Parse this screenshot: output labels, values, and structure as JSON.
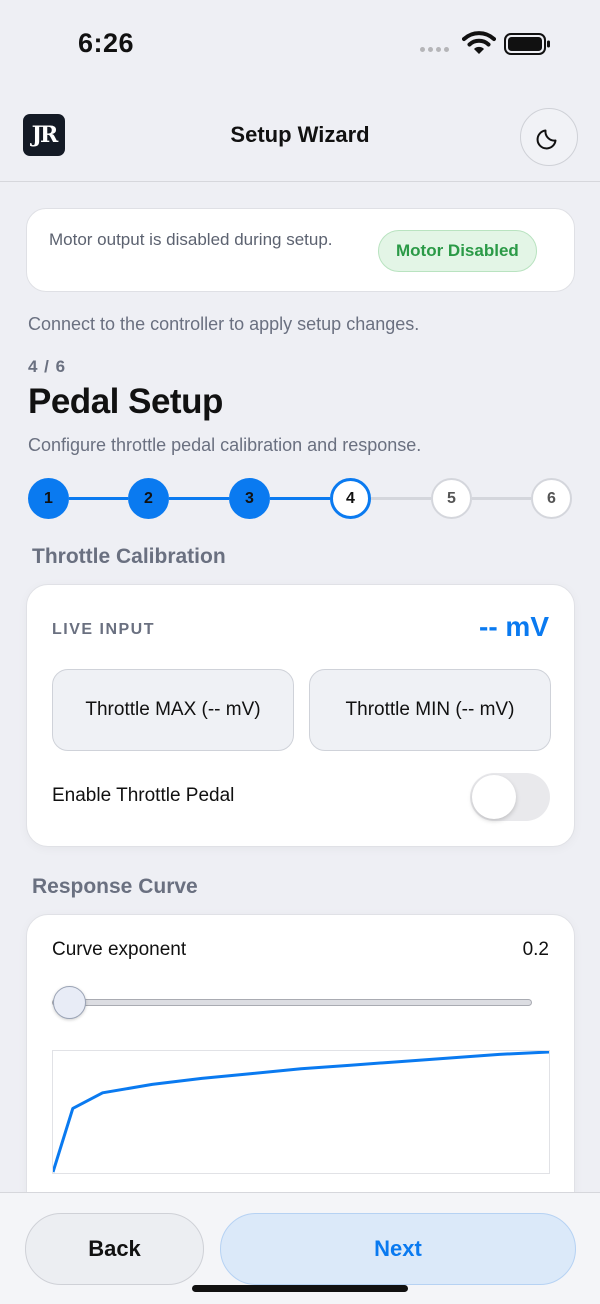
{
  "status_bar": {
    "time": "6:26"
  },
  "header": {
    "logo_text": "JR",
    "title": "Setup Wizard"
  },
  "motor_notice": {
    "text": "Motor output is disabled during setup.",
    "badge": "Motor Disabled"
  },
  "connect_note": "Connect to the controller to apply setup changes.",
  "step": {
    "count": "4 / 6",
    "title": "Pedal Setup",
    "description": "Configure throttle pedal calibration and response.",
    "labels": [
      "1",
      "2",
      "3",
      "4",
      "5",
      "6"
    ],
    "current": 4
  },
  "throttle_calibration": {
    "section_title": "Throttle Calibration",
    "live_label": "LIVE INPUT",
    "live_value": "-- mV",
    "max_button": "Throttle MAX (-- mV)",
    "min_button": "Throttle MIN (-- mV)",
    "enable_label": "Enable Throttle Pedal",
    "enabled": false
  },
  "response_curve": {
    "section_title": "Response Curve",
    "exponent_label": "Curve exponent",
    "exponent_value": "0.2",
    "slider_fraction": 0.0
  },
  "chart_data": {
    "type": "line",
    "exponent": 0.2,
    "x": [
      0.0,
      0.04,
      0.1,
      0.2,
      0.3,
      0.4,
      0.5,
      0.6,
      0.7,
      0.8,
      0.9,
      1.0
    ],
    "y": [
      0.0,
      0.53,
      0.66,
      0.73,
      0.78,
      0.82,
      0.86,
      0.89,
      0.92,
      0.95,
      0.98,
      1.0
    ],
    "xlim": [
      0,
      1
    ],
    "ylim": [
      0,
      1
    ],
    "grid": false,
    "color": "#0a7af0"
  },
  "footer": {
    "back_label": "Back",
    "next_label": "Next"
  },
  "colors": {
    "accent": "#0a7af0",
    "success": "#2b9a47",
    "inactive": "#d4d6dc"
  }
}
